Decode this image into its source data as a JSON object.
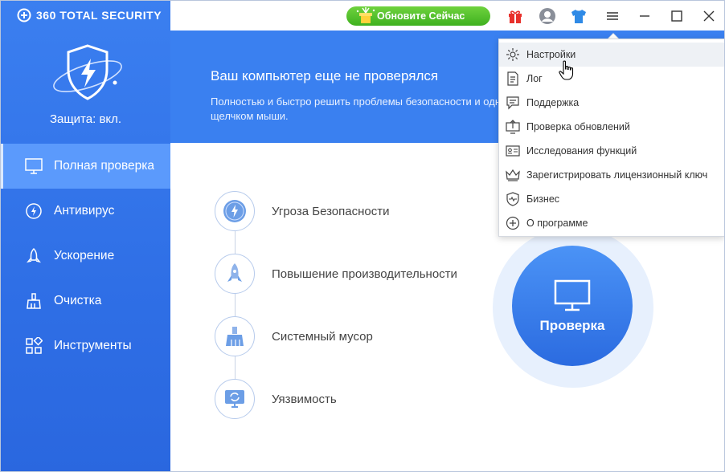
{
  "brand": {
    "name": "360 TOTAL SECURITY"
  },
  "sidebar": {
    "protection_status": "Защита: вкл.",
    "items": [
      {
        "label": "Полная проверка",
        "icon": "monitor-icon"
      },
      {
        "label": "Антивирус",
        "icon": "antivirus-icon"
      },
      {
        "label": "Ускорение",
        "icon": "rocket-icon"
      },
      {
        "label": "Очистка",
        "icon": "broom-icon"
      },
      {
        "label": "Инструменты",
        "icon": "tools-grid-icon"
      }
    ]
  },
  "topbar": {
    "update_label": "Обновите Сейчас",
    "icons": [
      "gift-icon",
      "avatar-icon",
      "tshirt-icon",
      "menu-icon",
      "minimize-icon",
      "maximize-icon",
      "close-icon"
    ]
  },
  "banner": {
    "title": "Ваш компьютер еще не проверялся",
    "subtitle": "Полностью и быстро решить проблемы безопасности и одним щелчком мыши."
  },
  "checks": [
    {
      "label": "Угроза Безопасности",
      "icon": "compass-icon"
    },
    {
      "label": "Повышение производительности",
      "icon": "rocket-icon"
    },
    {
      "label": "Системный мусор",
      "icon": "broom-icon"
    },
    {
      "label": "Уязвимость",
      "icon": "patch-icon"
    }
  ],
  "scan": {
    "label": "Проверка"
  },
  "menu": {
    "items": [
      {
        "label": "Настройки",
        "icon": "gear-icon"
      },
      {
        "label": "Лог",
        "icon": "document-icon"
      },
      {
        "label": "Поддержка",
        "icon": "chat-icon"
      },
      {
        "label": "Проверка обновлений",
        "icon": "update-icon"
      },
      {
        "label": "Исследования функций",
        "icon": "id-card-icon"
      },
      {
        "label": "Зарегистрировать лицензионный ключ",
        "icon": "crown-icon"
      },
      {
        "label": "Бизнес",
        "icon": "shield-pulse-icon"
      },
      {
        "label": "О программе",
        "icon": "info-plus-icon"
      }
    ]
  },
  "colors": {
    "sidebar": "#2f6fe6",
    "accent": "#3a80f0",
    "update_green": "#3fb11f"
  }
}
